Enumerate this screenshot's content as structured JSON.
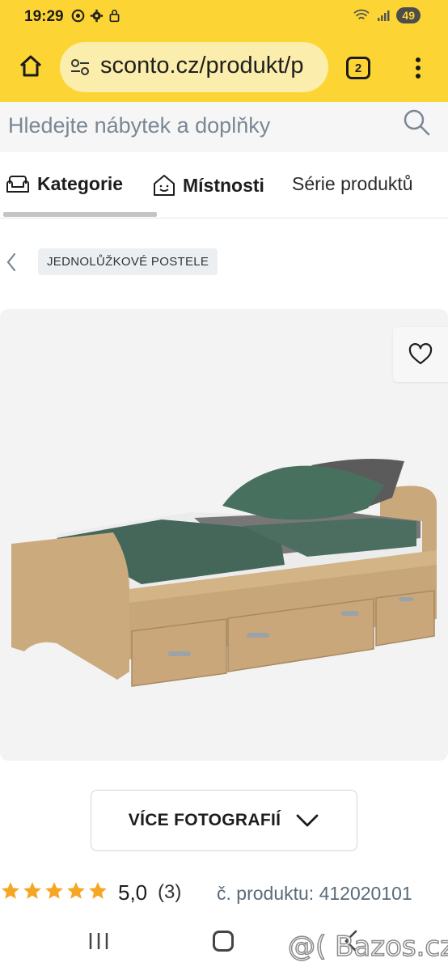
{
  "status_bar": {
    "time": "19:29",
    "battery": "49",
    "icons_left": [
      "chrome-icon",
      "settings-icon",
      "lock-icon"
    ],
    "icons_right": [
      "wifi-icon",
      "signal-icon",
      "battery-icon"
    ]
  },
  "browser": {
    "url": "sconto.cz/produkt/p",
    "tab_count": "2",
    "home_icon": "home-icon",
    "menu_icon": "more-vert-icon",
    "url_icon": "tune-icon"
  },
  "search": {
    "placeholder": "Hledejte nábytek a doplňky",
    "icon": "search-icon"
  },
  "category_tabs": [
    {
      "label": "Kategorie",
      "icon": "sofa-icon"
    },
    {
      "label": "Místnosti",
      "icon": "house-icon"
    },
    {
      "label": "Série produktů",
      "icon": ""
    }
  ],
  "breadcrumb": {
    "back_icon": "chevron-left-icon",
    "label": "JEDNOLŮŽKOVÉ POSTELE"
  },
  "product": {
    "favorite_icon": "heart-icon",
    "image_alt": "bed-image",
    "more_photos_label": "VÍCE FOTOGRAFIÍ",
    "rating": "5,0",
    "rating_count": "(3)",
    "stars": 5,
    "star_color": "#f5a623",
    "product_code": "č. produktu: 412020101"
  },
  "colors": {
    "accent": "#fcd535",
    "url_bg": "#fbedab"
  },
  "watermark": "@( Bazos.cz"
}
